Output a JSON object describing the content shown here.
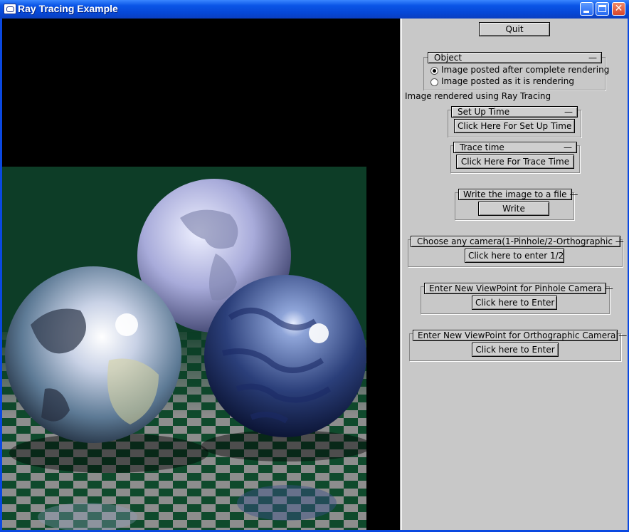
{
  "window": {
    "title": "Ray Tracing Example"
  },
  "panel": {
    "quit_label": "Quit",
    "object_group": {
      "title": "Object",
      "collapse": "—",
      "options": [
        {
          "label": "Image posted after complete rendering",
          "selected": true
        },
        {
          "label": "Image posted as it is rendering",
          "selected": false
        }
      ]
    },
    "status_text": "Image rendered using Ray Tracing",
    "setup_group": {
      "title": "Set Up Time",
      "collapse": "—",
      "button": "Click Here For Set Up Time"
    },
    "trace_group": {
      "title": "Trace time",
      "collapse": "—",
      "button": "Click Here For Trace Time"
    },
    "write_group": {
      "title": "Write the image to a file —",
      "button": "Write"
    },
    "camera_group": {
      "title": "Choose any camera(1-Pinhole/2-Orthographic —",
      "button": "Click here to enter 1/2"
    },
    "pinhole_group": {
      "title": "Enter New ViewPoint for Pinhole Camera —",
      "button": "Click here to Enter"
    },
    "ortho_group": {
      "title": "Enter New ViewPoint for Orthographic Camera —",
      "button": "Click here to Enter"
    }
  },
  "colors": {
    "titlebar": "#0a55e6",
    "panel": "#c8c8c8",
    "floor_green": "#0b3a24",
    "checker_gray": "#8a8a8a"
  },
  "icons": [
    "app-icon",
    "minimize-icon",
    "maximize-icon",
    "close-icon"
  ]
}
